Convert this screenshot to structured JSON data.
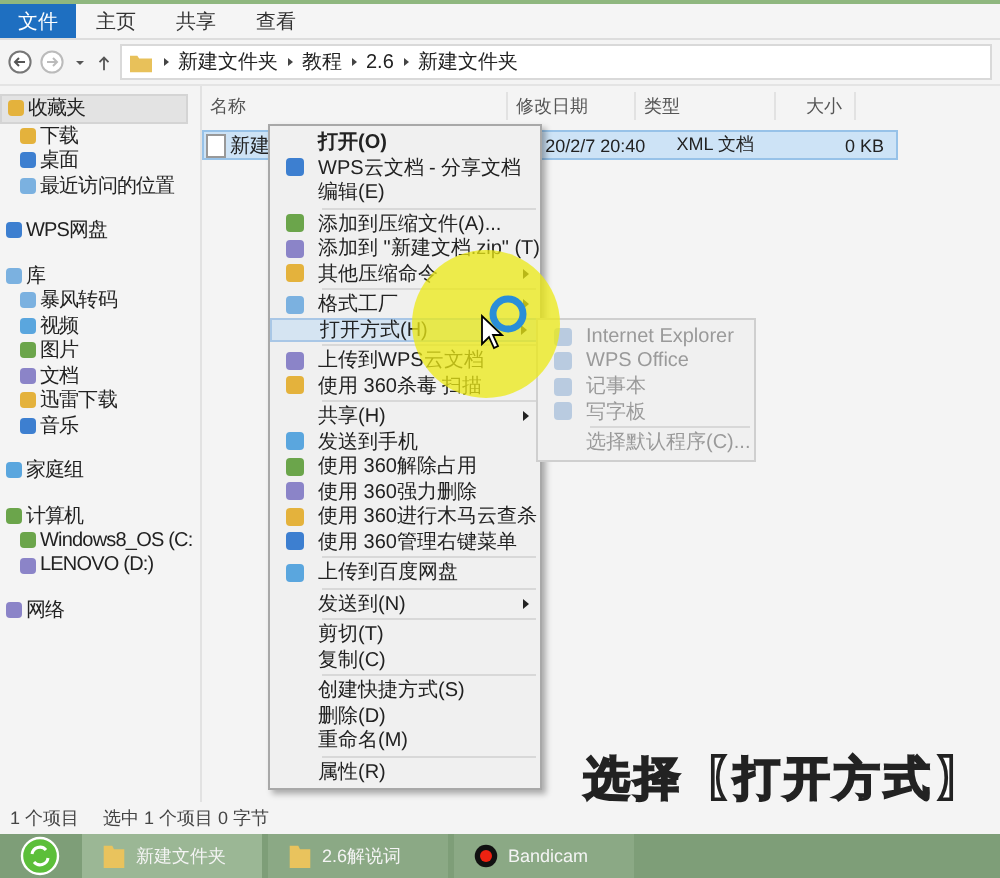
{
  "ribbon": {
    "tabs": [
      {
        "label": "文件",
        "selected": true
      },
      {
        "label": "主页",
        "selected": false
      },
      {
        "label": "共享",
        "selected": false
      },
      {
        "label": "查看",
        "selected": false
      }
    ]
  },
  "address_bar": {
    "path": [
      "新建文件夹",
      "教程",
      "2.6",
      "新建文件夹"
    ]
  },
  "sidebar": {
    "items": [
      {
        "label": "收藏夹",
        "selected": true,
        "children": [
          {
            "label": "下载"
          },
          {
            "label": "桌面"
          },
          {
            "label": "最近访问的位置"
          }
        ]
      },
      {
        "label": "WPS网盘",
        "selected": false
      },
      {
        "label": "库",
        "selected": false,
        "children": [
          {
            "label": "暴风转码"
          },
          {
            "label": "视频"
          },
          {
            "label": "图片"
          },
          {
            "label": "文档"
          },
          {
            "label": "迅雷下载"
          },
          {
            "label": "音乐"
          }
        ]
      },
      {
        "label": "家庭组",
        "selected": false
      },
      {
        "label": "计算机",
        "selected": false,
        "children": [
          {
            "label": "Windows8_OS (C:"
          },
          {
            "label": "LENOVO (D:)"
          }
        ]
      },
      {
        "label": "网络",
        "selected": false
      }
    ]
  },
  "table": {
    "columns": [
      "名称",
      "修改日期",
      "类型",
      "大小"
    ],
    "rows": [
      {
        "selected": true,
        "cells": [
          "新建",
          "20/2/7 20:40",
          "XML 文档",
          "0 KB"
        ]
      }
    ]
  },
  "context_menu": {
    "items": [
      {
        "kind": "item",
        "label": "打开(O)",
        "default": true,
        "icon": false,
        "submenu": false,
        "selected": false
      },
      {
        "kind": "item",
        "label": "WPS云文档 - 分享文档",
        "default": false,
        "icon": true,
        "submenu": false,
        "selected": false
      },
      {
        "kind": "item",
        "label": "编辑(E)",
        "default": false,
        "icon": false,
        "submenu": false,
        "selected": false
      },
      {
        "kind": "separator"
      },
      {
        "kind": "item",
        "label": "添加到压缩文件(A)...",
        "default": false,
        "icon": true,
        "submenu": false,
        "selected": false
      },
      {
        "kind": "item",
        "label": "添加到 \"新建文档.zip\" (T)",
        "default": false,
        "icon": true,
        "submenu": false,
        "selected": false
      },
      {
        "kind": "item",
        "label": "其他压缩命令",
        "default": false,
        "icon": true,
        "submenu": true,
        "selected": false
      },
      {
        "kind": "separator"
      },
      {
        "kind": "item",
        "label": "格式工厂",
        "default": false,
        "icon": true,
        "submenu": true,
        "selected": false
      },
      {
        "kind": "item",
        "label": "打开方式(H)",
        "default": false,
        "icon": false,
        "submenu": true,
        "selected": true
      },
      {
        "kind": "separator"
      },
      {
        "kind": "item",
        "label": "上传到WPS云文档",
        "default": false,
        "icon": true,
        "submenu": false,
        "selected": false
      },
      {
        "kind": "item",
        "label": "使用 360杀毒 扫描",
        "default": false,
        "icon": true,
        "submenu": false,
        "selected": false
      },
      {
        "kind": "separator"
      },
      {
        "kind": "item",
        "label": "共享(H)",
        "default": false,
        "icon": false,
        "submenu": true,
        "selected": false
      },
      {
        "kind": "item",
        "label": "发送到手机",
        "default": false,
        "icon": true,
        "submenu": false,
        "selected": false
      },
      {
        "kind": "item",
        "label": "使用 360解除占用",
        "default": false,
        "icon": true,
        "submenu": false,
        "selected": false
      },
      {
        "kind": "item",
        "label": "使用 360强力删除",
        "default": false,
        "icon": true,
        "submenu": false,
        "selected": false
      },
      {
        "kind": "item",
        "label": "使用 360进行木马云查杀",
        "default": false,
        "icon": true,
        "submenu": false,
        "selected": false
      },
      {
        "kind": "item",
        "label": "使用 360管理右键菜单",
        "default": false,
        "icon": true,
        "submenu": false,
        "selected": false
      },
      {
        "kind": "separator"
      },
      {
        "kind": "item",
        "label": "上传到百度网盘",
        "default": false,
        "icon": true,
        "submenu": false,
        "selected": false
      },
      {
        "kind": "separator"
      },
      {
        "kind": "item",
        "label": "发送到(N)",
        "default": false,
        "icon": false,
        "submenu": true,
        "selected": false
      },
      {
        "kind": "separator"
      },
      {
        "kind": "item",
        "label": "剪切(T)",
        "default": false,
        "icon": false,
        "submenu": false,
        "selected": false
      },
      {
        "kind": "item",
        "label": "复制(C)",
        "default": false,
        "icon": false,
        "submenu": false,
        "selected": false
      },
      {
        "kind": "separator"
      },
      {
        "kind": "item",
        "label": "创建快捷方式(S)",
        "default": false,
        "icon": false,
        "submenu": false,
        "selected": false
      },
      {
        "kind": "item",
        "label": "删除(D)",
        "default": false,
        "icon": false,
        "submenu": false,
        "selected": false
      },
      {
        "kind": "item",
        "label": "重命名(M)",
        "default": false,
        "icon": false,
        "submenu": false,
        "selected": false
      },
      {
        "kind": "separator"
      },
      {
        "kind": "item",
        "label": "属性(R)",
        "default": false,
        "icon": false,
        "submenu": false,
        "selected": false
      }
    ]
  },
  "submenu": {
    "items": [
      {
        "kind": "item",
        "label": "Internet Explorer",
        "icon": true
      },
      {
        "kind": "item",
        "label": "WPS Office",
        "icon": true
      },
      {
        "kind": "item",
        "label": "记事本",
        "icon": true
      },
      {
        "kind": "item",
        "label": "写字板",
        "icon": true
      },
      {
        "kind": "separator"
      },
      {
        "kind": "item",
        "label": "选择默认程序(C)...",
        "icon": false
      }
    ]
  },
  "status_bar": {
    "items": [
      "1 个项目",
      "选中 1 个项目 0 字节"
    ]
  },
  "caption": "选择【打开方式】",
  "taskbar": {
    "items": [
      {
        "label": "新建文件夹",
        "kind": "folder",
        "selected": true
      },
      {
        "label": "2.6解说词",
        "kind": "folder",
        "selected": false
      },
      {
        "label": "Bandicam",
        "kind": "record",
        "selected": false
      }
    ]
  }
}
